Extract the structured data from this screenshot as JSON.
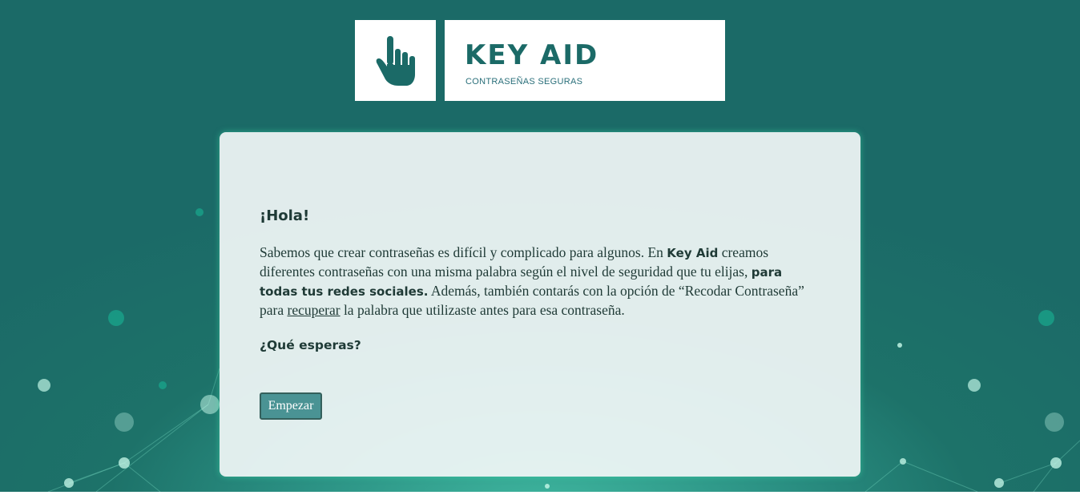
{
  "brand": {
    "name": "KEY AID",
    "tagline": "CONTRASEÑAS SEGURAS",
    "icon": "pointing-hand-icon"
  },
  "card": {
    "greeting": "¡Hola!",
    "intro": {
      "p1": "Sabemos que crear contraseñas es difícil y complicado para algunos. En ",
      "b1": "Key Aid",
      "p2": " creamos diferentes contraseñas con una misma palabra según el nivel de seguridad que tu elijas, ",
      "b2": "para todas tus redes sociales.",
      "p3": " Además, también contarás con la opción de “Recodar Contraseña” para ",
      "u1": "recuperar",
      "p4": " la palabra que utilizaste antes para esa contraseña."
    },
    "question": "¿Qué esperas?",
    "start_button": "Empezar"
  },
  "colors": {
    "brand_teal": "#1b6a67",
    "button_bg": "#4a9394",
    "card_glow": "#3cdcaa"
  }
}
